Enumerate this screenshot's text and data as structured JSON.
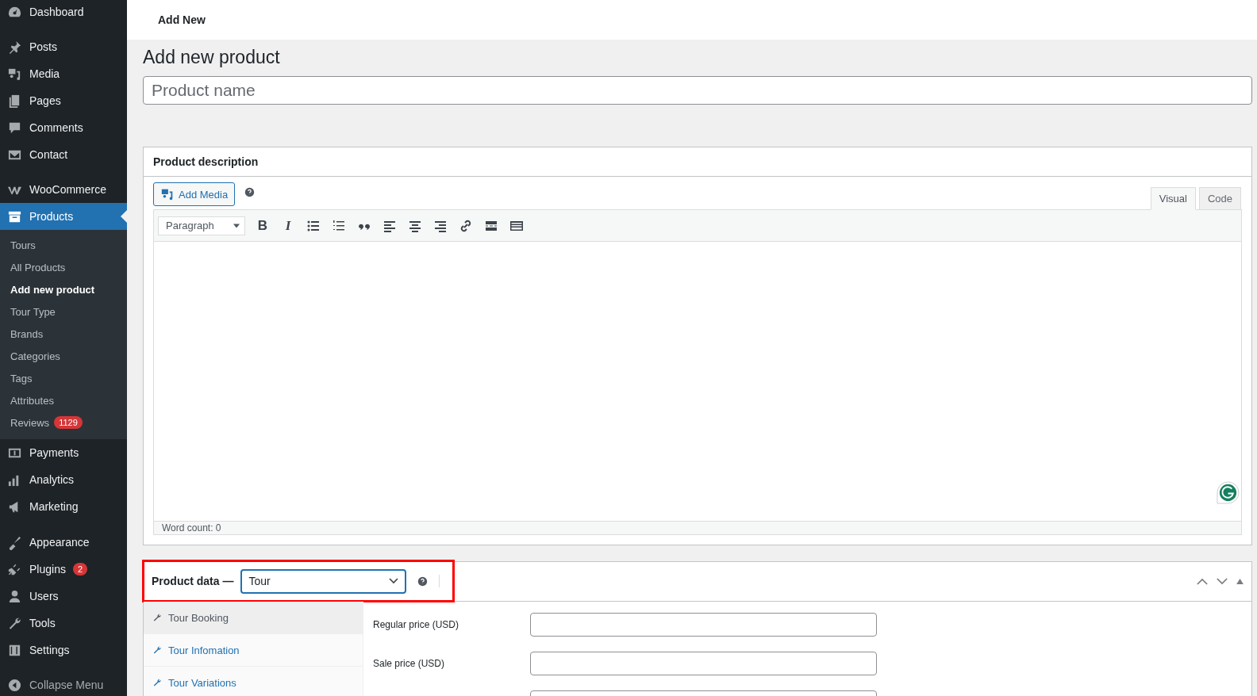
{
  "top_bar": {
    "title": "Add New"
  },
  "sidebar": {
    "groups": [
      [
        {
          "label": "Dashboard",
          "selected": false
        }
      ],
      [
        {
          "label": "Posts",
          "selected": false
        },
        {
          "label": "Media",
          "selected": false
        },
        {
          "label": "Pages",
          "selected": false
        },
        {
          "label": "Comments",
          "selected": false
        },
        {
          "label": "Contact",
          "selected": false
        }
      ],
      [
        {
          "label": "WooCommerce",
          "selected": false
        },
        {
          "label": "Products",
          "selected": true,
          "children": [
            {
              "label": "Tours",
              "selected": false
            },
            {
              "label": "All Products",
              "selected": false
            },
            {
              "label": "Add new product",
              "selected": true
            },
            {
              "label": "Tour Type",
              "selected": false
            },
            {
              "label": "Brands",
              "selected": false
            },
            {
              "label": "Categories",
              "selected": false
            },
            {
              "label": "Tags",
              "selected": false
            },
            {
              "label": "Attributes",
              "selected": false
            },
            {
              "label": "Reviews",
              "selected": false,
              "badge": "1129"
            }
          ]
        }
      ],
      [
        {
          "label": "Payments",
          "selected": false
        },
        {
          "label": "Analytics",
          "selected": false
        },
        {
          "label": "Marketing",
          "selected": false
        }
      ],
      [
        {
          "label": "Appearance",
          "selected": false
        },
        {
          "label": "Plugins",
          "selected": false,
          "badge": "2"
        },
        {
          "label": "Users",
          "selected": false
        },
        {
          "label": "Tools",
          "selected": false
        },
        {
          "label": "Settings",
          "selected": false
        }
      ]
    ],
    "collapse_label": "Collapse Menu"
  },
  "page": {
    "heading": "Add new product",
    "title_field": {
      "placeholder": "Product name"
    }
  },
  "description_panel": {
    "title": "Product description",
    "add_media": "Add Media",
    "editor_tabs": [
      {
        "label": "Visual",
        "selected": true
      },
      {
        "label": "Code",
        "selected": false
      }
    ],
    "format_select": "Paragraph",
    "toolbar_glyphs": [
      "B",
      "I"
    ],
    "word_count": "Word count: 0"
  },
  "product_data": {
    "title": "Product data —",
    "type_select": "Tour",
    "tabs": [
      {
        "label": "Tour Booking",
        "selected": true
      },
      {
        "label": "Tour Infomation",
        "selected": false
      },
      {
        "label": "Tour Variations",
        "selected": false
      }
    ],
    "fields": [
      {
        "kind": "labeled",
        "label": "Regular price (USD)"
      },
      {
        "kind": "labeled",
        "label": "Sale price (USD)"
      },
      {
        "kind": "unlabeled"
      }
    ]
  }
}
